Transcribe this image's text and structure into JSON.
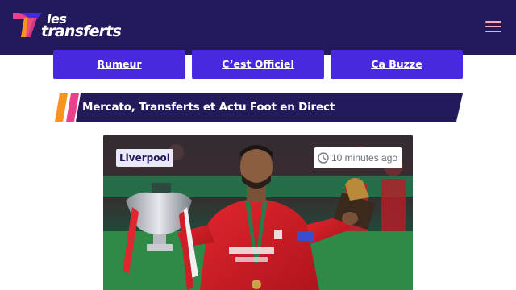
{
  "header": {
    "logo_line1": "les",
    "logo_line2": "transferts",
    "menu_icon": "hamburger-icon"
  },
  "nav": {
    "items": [
      {
        "label": "Rumeur"
      },
      {
        "label": "C’est Officiel"
      },
      {
        "label": "Ca Buzze"
      }
    ]
  },
  "section": {
    "title": "Mercato, Transferts et Actu Foot en Direct"
  },
  "article": {
    "tag": "Liverpool",
    "time": "10 minutes ago",
    "time_icon": "clock-icon"
  },
  "colors": {
    "header_bg": "#231a5c",
    "nav_button_bg": "#4a28e0",
    "accent_orange": "#f7941d",
    "accent_pink": "#ec3f8c",
    "banner_bg": "#231a5c"
  }
}
